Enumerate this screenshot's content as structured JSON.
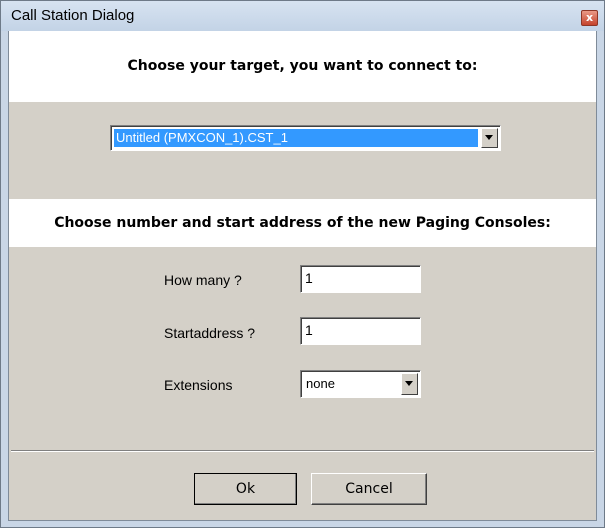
{
  "window": {
    "title": "Call Station Dialog",
    "close_glyph": "x"
  },
  "target_section": {
    "heading": "Choose your target, you want to connect to:",
    "selected_target": "Untitled (PMXCON_1).CST_1"
  },
  "consoles_section": {
    "heading": "Choose number and start address of the new Paging Consoles:",
    "how_many_label": "How many ?",
    "how_many_value": "1",
    "startaddress_label": "Startaddress ?",
    "startaddress_value": "1",
    "extensions_label": "Extensions",
    "extensions_value": "none"
  },
  "buttons": {
    "ok_label": "Ok",
    "cancel_label": "Cancel"
  },
  "colors": {
    "selection_highlight": "#3399ff",
    "dialog_face": "#d4d0c8",
    "title_bar": "#c9d6e6",
    "close_button": "#c5432c"
  },
  "icons": {
    "close": "close-icon",
    "dropdown": "chevron-down-icon"
  }
}
